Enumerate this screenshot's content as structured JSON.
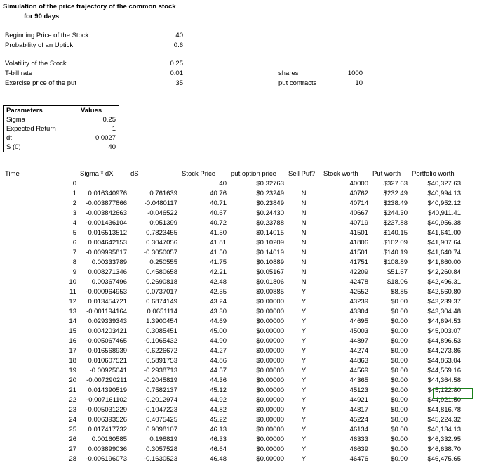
{
  "title_line1": "Simulation of the price trajectory of the common stock",
  "title_line2": "for 90 days",
  "inputs": {
    "begin_price_label": "Beginning Price of the Stock",
    "begin_price": 40,
    "prob_uptick_label": "Probability of an Uptick",
    "prob_uptick": 0.6,
    "volatility_label": "Volatility of the Stock",
    "volatility": 0.25,
    "tbill_label": "T-bill rate",
    "tbill": 0.01,
    "exercise_label": "Exercise price of the put",
    "exercise": 35,
    "shares_label": "shares",
    "shares": 1000,
    "put_contracts_label": "put contracts",
    "put_contracts": 10
  },
  "parameters": {
    "header_label": "Parameters",
    "header_value": "Values",
    "rows": [
      {
        "label": "Sigma",
        "value": "0.25"
      },
      {
        "label": "Expected Return",
        "value": "1"
      },
      {
        "label": "dt",
        "value": "0.0027"
      },
      {
        "label": "S (0)",
        "value": "40"
      }
    ]
  },
  "table": {
    "headers": {
      "time": "Time",
      "sigma_dx": "Sigma * dX",
      "ds": "dS",
      "stock_price": "Stock Price",
      "put_price": "put option price",
      "sell_put": "Sell Put?",
      "stock_worth": "Stock worth",
      "put_worth": "Put worth",
      "portfolio": "Portfolio worth"
    },
    "rows": [
      {
        "t": "0",
        "sdx": "",
        "ds": "",
        "sp": "40",
        "pp": "$0.32763",
        "sell": "",
        "sw": "40000",
        "pw": "$327.63",
        "pf": "$40,327.63"
      },
      {
        "t": "1",
        "sdx": "0.016340976",
        "ds": "0.761639",
        "sp": "40.76",
        "pp": "$0.23249",
        "sell": "N",
        "sw": "40762",
        "pw": "$232.49",
        "pf": "$40,994.13"
      },
      {
        "t": "2",
        "sdx": "-0.003877866",
        "ds": "-0.0480117",
        "sp": "40.71",
        "pp": "$0.23849",
        "sell": "N",
        "sw": "40714",
        "pw": "$238.49",
        "pf": "$40,952.12"
      },
      {
        "t": "3",
        "sdx": "-0.003842663",
        "ds": "-0.046522",
        "sp": "40.67",
        "pp": "$0.24430",
        "sell": "N",
        "sw": "40667",
        "pw": "$244.30",
        "pf": "$40,911.41"
      },
      {
        "t": "4",
        "sdx": "-0.001436104",
        "ds": "0.051399",
        "sp": "40.72",
        "pp": "$0.23788",
        "sell": "N",
        "sw": "40719",
        "pw": "$237.88",
        "pf": "$40,956.38"
      },
      {
        "t": "5",
        "sdx": "0.016513512",
        "ds": "0.7823455",
        "sp": "41.50",
        "pp": "$0.14015",
        "sell": "N",
        "sw": "41501",
        "pw": "$140.15",
        "pf": "$41,641.00"
      },
      {
        "t": "6",
        "sdx": "0.004642153",
        "ds": "0.3047056",
        "sp": "41.81",
        "pp": "$0.10209",
        "sell": "N",
        "sw": "41806",
        "pw": "$102.09",
        "pf": "$41,907.64"
      },
      {
        "t": "7",
        "sdx": "-0.009995817",
        "ds": "-0.3050057",
        "sp": "41.50",
        "pp": "$0.14019",
        "sell": "N",
        "sw": "41501",
        "pw": "$140.19",
        "pf": "$41,640.74"
      },
      {
        "t": "8",
        "sdx": "0.00333789",
        "ds": "0.250555",
        "sp": "41.75",
        "pp": "$0.10889",
        "sell": "N",
        "sw": "41751",
        "pw": "$108.89",
        "pf": "$41,860.00"
      },
      {
        "t": "9",
        "sdx": "0.008271346",
        "ds": "0.4580658",
        "sp": "42.21",
        "pp": "$0.05167",
        "sell": "N",
        "sw": "42209",
        "pw": "$51.67",
        "pf": "$42,260.84"
      },
      {
        "t": "10",
        "sdx": "0.00367496",
        "ds": "0.2690818",
        "sp": "42.48",
        "pp": "$0.01806",
        "sell": "N",
        "sw": "42478",
        "pw": "$18.06",
        "pf": "$42,496.31"
      },
      {
        "t": "11",
        "sdx": "-0.000964953",
        "ds": "0.0737017",
        "sp": "42.55",
        "pp": "$0.00885",
        "sell": "Y",
        "sw": "42552",
        "pw": "$8.85",
        "pf": "$42,560.80"
      },
      {
        "t": "12",
        "sdx": "0.013454721",
        "ds": "0.6874149",
        "sp": "43.24",
        "pp": "$0.00000",
        "sell": "Y",
        "sw": "43239",
        "pw": "$0.00",
        "pf": "$43,239.37"
      },
      {
        "t": "13",
        "sdx": "-0.001194164",
        "ds": "0.0651114",
        "sp": "43.30",
        "pp": "$0.00000",
        "sell": "Y",
        "sw": "43304",
        "pw": "$0.00",
        "pf": "$43,304.48"
      },
      {
        "t": "14",
        "sdx": "0.029339343",
        "ds": "1.3900454",
        "sp": "44.69",
        "pp": "$0.00000",
        "sell": "Y",
        "sw": "44695",
        "pw": "$0.00",
        "pf": "$44,694.53"
      },
      {
        "t": "15",
        "sdx": "0.004203421",
        "ds": "0.3085451",
        "sp": "45.00",
        "pp": "$0.00000",
        "sell": "Y",
        "sw": "45003",
        "pw": "$0.00",
        "pf": "$45,003.07"
      },
      {
        "t": "16",
        "sdx": "-0.005067465",
        "ds": "-0.1065432",
        "sp": "44.90",
        "pp": "$0.00000",
        "sell": "Y",
        "sw": "44897",
        "pw": "$0.00",
        "pf": "$44,896.53"
      },
      {
        "t": "17",
        "sdx": "-0.016568939",
        "ds": "-0.6226672",
        "sp": "44.27",
        "pp": "$0.00000",
        "sell": "Y",
        "sw": "44274",
        "pw": "$0.00",
        "pf": "$44,273.86"
      },
      {
        "t": "18",
        "sdx": "0.010607521",
        "ds": "0.5891753",
        "sp": "44.86",
        "pp": "$0.00000",
        "sell": "Y",
        "sw": "44863",
        "pw": "$0.00",
        "pf": "$44,863.04"
      },
      {
        "t": "19",
        "sdx": "-0.00925041",
        "ds": "-0.2938713",
        "sp": "44.57",
        "pp": "$0.00000",
        "sell": "Y",
        "sw": "44569",
        "pw": "$0.00",
        "pf": "$44,569.16"
      },
      {
        "t": "20",
        "sdx": "-0.007290211",
        "ds": "-0.2045819",
        "sp": "44.36",
        "pp": "$0.00000",
        "sell": "Y",
        "sw": "44365",
        "pw": "$0.00",
        "pf": "$44,364.58"
      },
      {
        "t": "21",
        "sdx": "0.014390519",
        "ds": "0.7582137",
        "sp": "45.12",
        "pp": "$0.00000",
        "sell": "Y",
        "sw": "45123",
        "pw": "$0.00",
        "pf": "$45,122.80"
      },
      {
        "t": "22",
        "sdx": "-0.007161102",
        "ds": "-0.2012974",
        "sp": "44.92",
        "pp": "$0.00000",
        "sell": "Y",
        "sw": "44921",
        "pw": "$0.00",
        "pf": "$44,921.50"
      },
      {
        "t": "23",
        "sdx": "-0.005031229",
        "ds": "-0.1047223",
        "sp": "44.82",
        "pp": "$0.00000",
        "sell": "Y",
        "sw": "44817",
        "pw": "$0.00",
        "pf": "$44,816.78"
      },
      {
        "t": "24",
        "sdx": "0.006393526",
        "ds": "0.4075425",
        "sp": "45.22",
        "pp": "$0.00000",
        "sell": "Y",
        "sw": "45224",
        "pw": "$0.00",
        "pf": "$45,224.32"
      },
      {
        "t": "25",
        "sdx": "0.017417732",
        "ds": "0.9098107",
        "sp": "46.13",
        "pp": "$0.00000",
        "sell": "Y",
        "sw": "46134",
        "pw": "$0.00",
        "pf": "$46,134.13"
      },
      {
        "t": "26",
        "sdx": "0.00160585",
        "ds": "0.198819",
        "sp": "46.33",
        "pp": "$0.00000",
        "sell": "Y",
        "sw": "46333",
        "pw": "$0.00",
        "pf": "$46,332.95"
      },
      {
        "t": "27",
        "sdx": "0.003899036",
        "ds": "0.3057528",
        "sp": "46.64",
        "pp": "$0.00000",
        "sell": "Y",
        "sw": "46639",
        "pw": "$0.00",
        "pf": "$46,638.70"
      },
      {
        "t": "28",
        "sdx": "-0.006196073",
        "ds": "-0.1630523",
        "sp": "46.48",
        "pp": "$0.00000",
        "sell": "Y",
        "sw": "46476",
        "pw": "$0.00",
        "pf": "$46,475.65"
      }
    ]
  },
  "colors": {
    "selection": "#1a7f1a"
  }
}
